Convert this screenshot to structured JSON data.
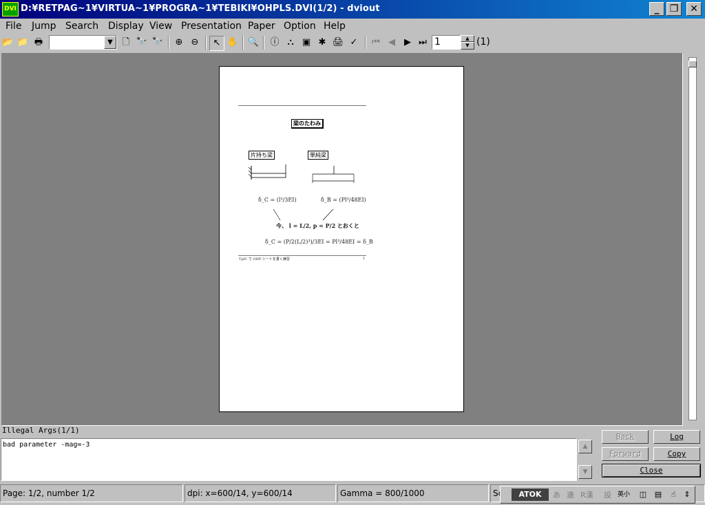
{
  "window": {
    "title": "D:¥RETPAG~1¥VIRTUA~1¥PROGRA~1¥TEBIKI¥OHPLS.DVI(1/2) - dviout",
    "app_icon_label": "DVI",
    "min_glyph": "_",
    "max_glyph": "❐",
    "close_glyph": "✕"
  },
  "menu": {
    "file": "File",
    "jump": "Jump",
    "search": "Search",
    "display": "Display",
    "view": "View",
    "presentation": "Presentation",
    "paper": "Paper",
    "option": "Option",
    "help": "Help"
  },
  "toolbar": {
    "combo_value": "",
    "page_number": "1",
    "page_total": "(1)",
    "icons": {
      "open": "📂",
      "reopen": "📁",
      "print": "🖶",
      "preview": "🗋",
      "find": "🔭",
      "find_next": "🔭",
      "zoom_in": "⊕",
      "zoom_out": "⊖",
      "select": "↖",
      "hand": "✋",
      "loupe": "🔍",
      "info": "ⓘ",
      "fonts": "⛬",
      "frame": "▣",
      "settings": "✱",
      "printer": "🖨",
      "check": "✓",
      "first": "⏮",
      "prev": "◀",
      "next": "▶",
      "last": "⏭",
      "dropdown": "▼",
      "spin_up": "▲",
      "spin_down": "▼"
    }
  },
  "document": {
    "title_box": "梁のたわみ",
    "left_beam_label": "片持ち梁",
    "right_beam_label": "単純梁",
    "eq_left": "δ_C = (l³/3EI)",
    "eq_right": "δ_B = (Pl³/48EI)",
    "middle_text": "今、 l = L/2, p = P/2 とおくと",
    "eq_bottom": "δ_C = (P/2(L/2)³)/3EI = Pl³/48EI = δ_B",
    "footer_left": "TpIC で OHP シートを書く練習",
    "footer_right": "1"
  },
  "log": {
    "label": "Illegal Args(1/1)",
    "text": "bad parameter -mag=-3",
    "scroll_up": "▲",
    "scroll_down": "▼"
  },
  "buttons": {
    "back": "Back",
    "log": "Log",
    "forward": "Forward",
    "copy": "Copy",
    "close": "Close"
  },
  "status": {
    "page": "Page: 1/2, number 1/2",
    "dpi": "dpi: x=600/14, y=600/14",
    "gamma": "Gamma = 800/1000",
    "extra": "Sc"
  },
  "ime": {
    "name": "ATOK",
    "k1": "あ",
    "k2": "連",
    "k3": "R漢",
    "k4": "設",
    "k5": "英小"
  }
}
